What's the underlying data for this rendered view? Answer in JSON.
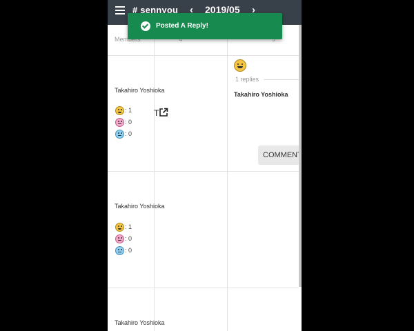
{
  "app_bar": {
    "channel": "# sennyou",
    "month": "2019/05",
    "prev_icon": "chevron-left-icon",
    "next_icon": "chevron-right-icon",
    "menu_icon": "hamburger-menu-icon",
    "background": "#38404a"
  },
  "table_header": {
    "members_label": "Members",
    "day_col_1": "4",
    "day_col_2": "5"
  },
  "rows": [
    {
      "member": "Takahiro Yoshioka",
      "stats": [
        ": 1",
        ": 0",
        ": 0"
      ]
    },
    {
      "member": "Takahiro Yoshioka",
      "stats": [
        ": 1",
        ": 0",
        ": 0"
      ]
    },
    {
      "member": "Takahiro Yoshioka"
    }
  ],
  "post": {
    "replies": "1 replies",
    "author": "Takahiro Yoshioka",
    "edit_fragment": "T",
    "comment_label": "COMMENT"
  },
  "toast": {
    "message": "Posted A Reply!",
    "color": "#178a4f"
  }
}
